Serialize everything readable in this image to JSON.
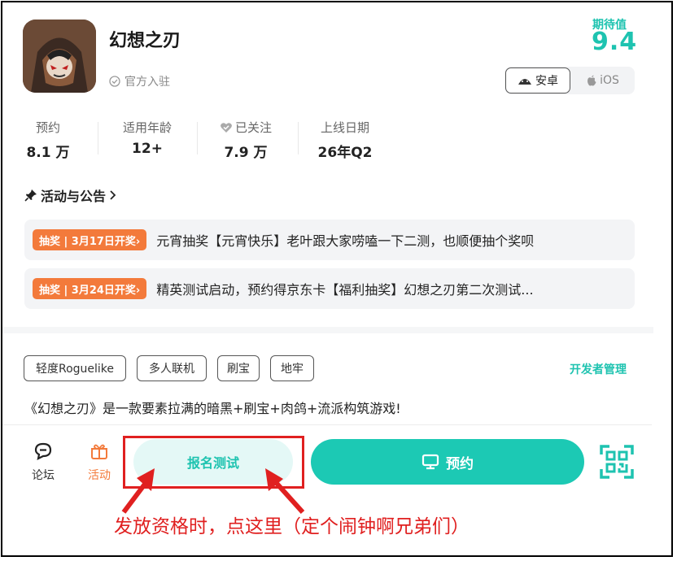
{
  "colors": {
    "accent": "#1ec3b0",
    "tag_orange": "#f37a3b",
    "annotation_red": "#e02020"
  },
  "header": {
    "title": "幻想之刃",
    "official_label": "官方入驻",
    "expectation_label": "期待值",
    "expectation_score": "9.4",
    "platforms": [
      {
        "label": "安卓",
        "icon": "android-icon",
        "selected": true
      },
      {
        "label": "iOS",
        "icon": "apple-icon",
        "selected": false
      }
    ]
  },
  "stats": [
    {
      "label": "预约",
      "value": "8.1 万"
    },
    {
      "label": "适用年龄",
      "value": "12+"
    },
    {
      "label": "已关注",
      "value": "7.9 万",
      "icon": "heart-check-icon"
    },
    {
      "label": "上线日期",
      "value": "26年Q2"
    }
  ],
  "activities": {
    "header": "活动与公告",
    "items": [
      {
        "tag": "抽奖 | 3月17日开奖›",
        "text": "元宵抽奖【元宵快乐】老叶跟大家唠嗑一下二测，也顺便抽个奖呗"
      },
      {
        "tag": "抽奖 | 3月24日开奖›",
        "text": "精英测试启动，预约得京东卡【福利抽奖】幻想之刃第二次测试..."
      }
    ]
  },
  "tags": [
    "轻度Roguelike",
    "多人联机",
    "刷宝",
    "地牢"
  ],
  "developer_link": "开发者管理",
  "description": "《幻想之刃》是一款要素拉满的暗黑+刷宝+肉鸽+流派构筑游戏!",
  "bottom_bar": {
    "forum_label": "论坛",
    "activity_label": "活动",
    "signup_label": "报名测试",
    "reserve_label": "预约"
  },
  "annotation": "发放资格时，点这里（定个闹钟啊兄弟们）"
}
